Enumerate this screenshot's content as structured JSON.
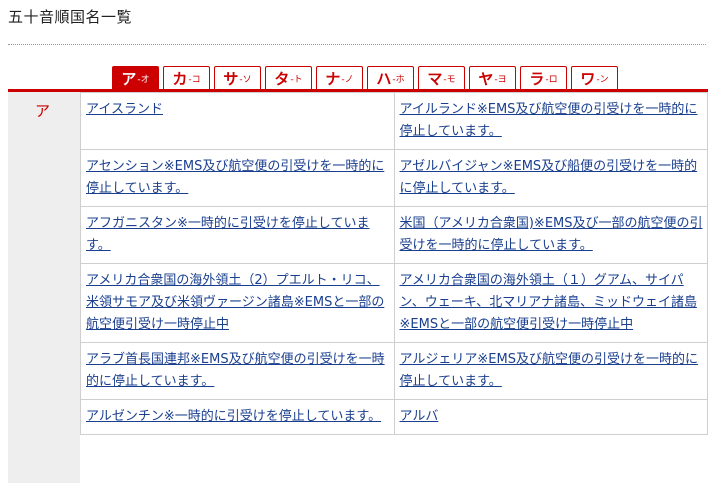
{
  "page": {
    "title": "五十音順国名一覧"
  },
  "tabs": [
    {
      "main": "ア",
      "sub": "-オ",
      "active": true
    },
    {
      "main": "カ",
      "sub": "-コ"
    },
    {
      "main": "サ",
      "sub": "-ソ"
    },
    {
      "main": "タ",
      "sub": "-ト"
    },
    {
      "main": "ナ",
      "sub": "-ノ"
    },
    {
      "main": "ハ",
      "sub": "-ホ"
    },
    {
      "main": "マ",
      "sub": "-モ"
    },
    {
      "main": "ヤ",
      "sub": "-ヨ"
    },
    {
      "main": "ラ",
      "sub": "-ロ"
    },
    {
      "main": "ワ",
      "sub": "-ン"
    }
  ],
  "section": {
    "label": "ア"
  },
  "rows": [
    [
      "アイスランド",
      "アイルランド※EMS及び航空便の引受けを一時的に停止しています。"
    ],
    [
      "アセンション※EMS及び航空便の引受けを一時的に停止しています。",
      "アゼルバイジャン※EMS及び船便の引受けを一時的に停止しています。"
    ],
    [
      "アフガニスタン※一時的に引受けを停止しています。",
      "米国（アメリカ合衆国)※EMS及び一部の航空便の引受けを一時的に停止しています。"
    ],
    [
      "アメリカ合衆国の海外領土（2）プエルト・リコ、米領サモア及び米領ヴァージン諸島※EMSと一部の航空便引受け一時停止中",
      "アメリカ合衆国の海外領土（１）グアム、サイパン、ウェーキ、北マリアナ諸島、ミッドウェイ諸島※EMSと一部の航空便引受け一時停止中"
    ],
    [
      "アラブ首長国連邦※EMS及び航空便の引受けを一時的に停止しています。",
      "アルジェリア※EMS及び航空便の引受けを一時的に停止しています。"
    ],
    [
      "アルゼンチン※一時的に引受けを停止しています。",
      "アルバ"
    ]
  ]
}
